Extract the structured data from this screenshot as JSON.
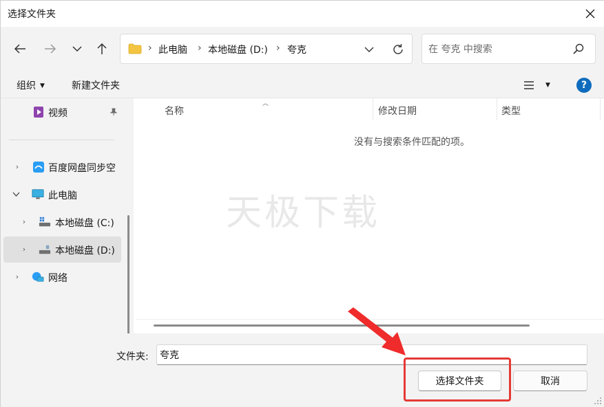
{
  "window": {
    "title": "选择文件夹",
    "close_label": "×"
  },
  "nav": {
    "back_icon": "arrow-left-icon",
    "forward_icon": "arrow-right-icon",
    "recent_icon": "chevron-down-icon",
    "up_icon": "arrow-up-icon"
  },
  "address": {
    "breadcrumbs": [
      "此电脑",
      "本地磁盘 (D:)",
      "夸克"
    ],
    "separator": "›"
  },
  "search": {
    "placeholder": "在 夸克 中搜索",
    "value": ""
  },
  "toolbar": {
    "organize_label": "组织",
    "new_folder_label": "新建文件夹",
    "help_label": "?"
  },
  "sidebar": {
    "items": [
      {
        "label": "视频",
        "icon": "video-folder-icon",
        "pinned": true
      },
      {
        "label": "百度网盘同步空",
        "icon": "baidu-netdisk-icon",
        "expand": "collapsed"
      },
      {
        "label": "此电脑",
        "icon": "computer-icon",
        "expand": "expanded"
      },
      {
        "label": "本地磁盘 (C:)",
        "icon": "drive-c-icon",
        "expand": "collapsed"
      },
      {
        "label": "本地磁盘 (D:)",
        "icon": "drive-d-icon",
        "expand": "collapsed",
        "selected": true
      },
      {
        "label": "网络",
        "icon": "network-icon",
        "expand": "collapsed"
      }
    ]
  },
  "content": {
    "columns": [
      "名称",
      "修改日期",
      "类型"
    ],
    "empty_message": "没有与搜索条件匹配的项。",
    "watermark": "天极下载"
  },
  "footer": {
    "folder_label": "文件夹:",
    "folder_value": "夸克",
    "select_button": "选择文件夹",
    "cancel_button": "取消"
  },
  "colors": {
    "accent": "#0f6cbd",
    "highlight": "#e53935",
    "folder": "#f4c542",
    "pane_bg": "#f3f3f3"
  }
}
